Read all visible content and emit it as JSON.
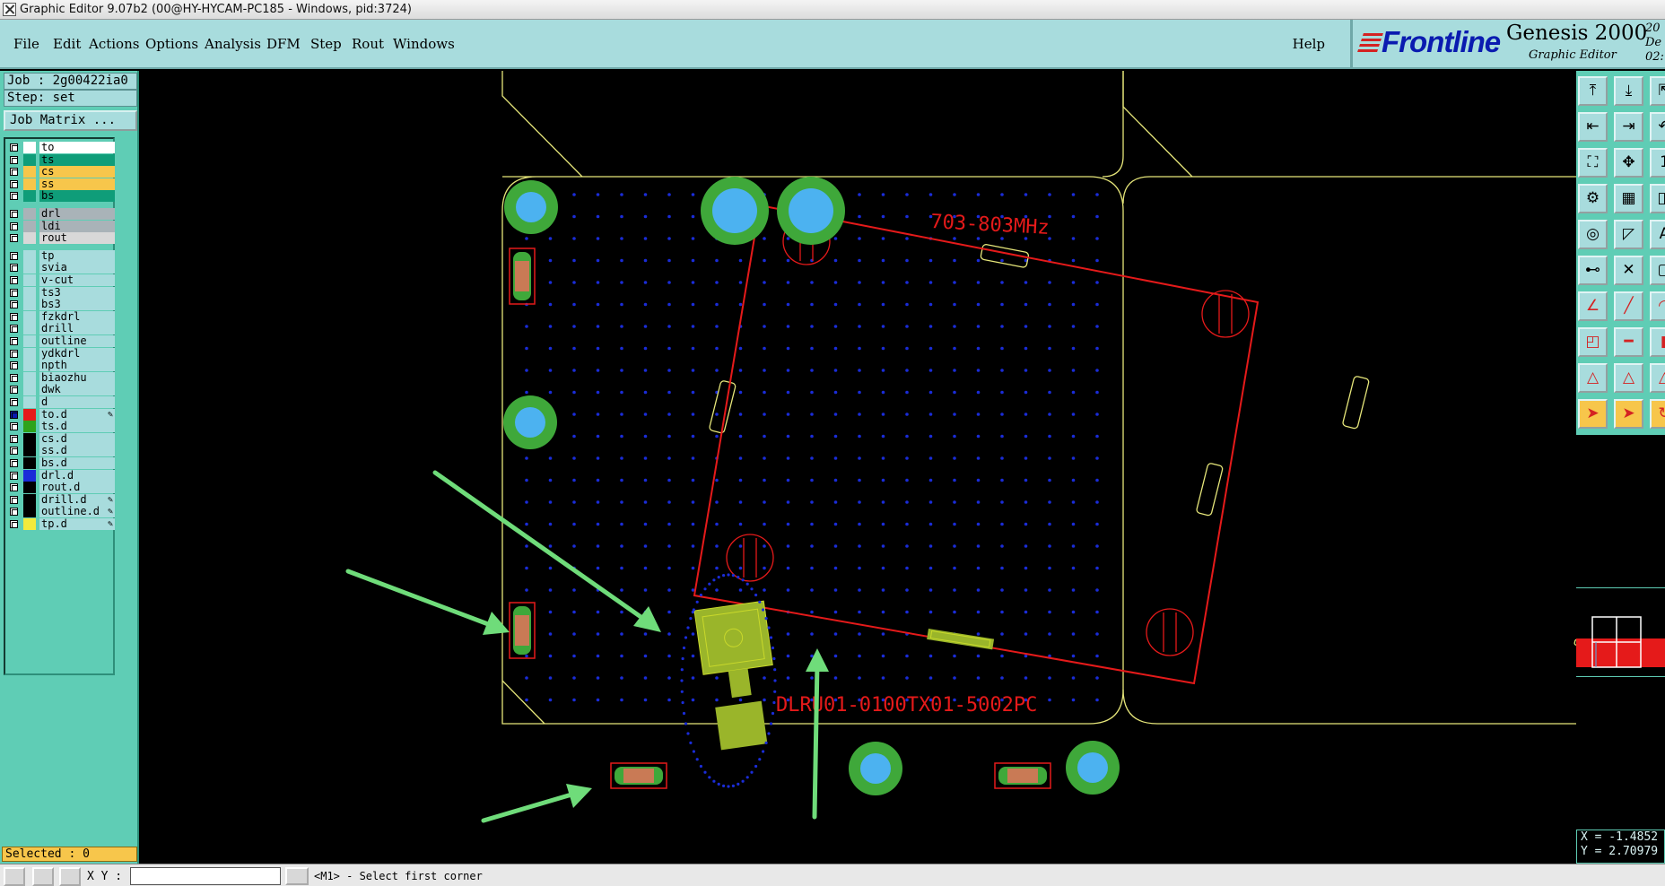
{
  "window": {
    "title": "Graphic Editor 9.07b2 (00@HY-HYCAM-PC185 - Windows, pid:3724)"
  },
  "menu": {
    "items": [
      "File",
      "Edit",
      "Actions",
      "Options",
      "Analysis",
      "DFM",
      "Step",
      "Rout",
      "Windows"
    ],
    "help": "Help"
  },
  "logo": {
    "brand": "Frontline",
    "product": "Genesis 2000",
    "subtitle": "Graphic Editor",
    "date_line1": "20 De",
    "date_line2": "02:"
  },
  "job": {
    "job_label": "Job : 2g00422ia0",
    "step_label": "Step: set",
    "matrix_button": "Job Matrix ..."
  },
  "layers": [
    {
      "name": "to",
      "color": "#ffffff",
      "active": false,
      "brush": false
    },
    {
      "name": "ts",
      "color": "#0f9d79",
      "active": false,
      "brush": false
    },
    {
      "name": "cs",
      "color": "#f7c64b",
      "active": false,
      "brush": false
    },
    {
      "name": "ss",
      "color": "#f7c64b",
      "active": false,
      "brush": false
    },
    {
      "name": "bs",
      "color": "#0f9d79",
      "active": false,
      "brush": false
    },
    {
      "name": "drl",
      "color": "#a9b3b8",
      "active": false,
      "brush": false
    },
    {
      "name": "ldi",
      "color": "#a9b3b8",
      "active": false,
      "brush": false
    },
    {
      "name": "rout",
      "color": "#d8d8d8",
      "active": false,
      "brush": false
    },
    {
      "name": "tp",
      "color": "#a8dcdd",
      "active": false,
      "brush": false
    },
    {
      "name": "svia",
      "color": "#a8dcdd",
      "active": false,
      "brush": false
    },
    {
      "name": "v-cut",
      "color": "#a8dcdd",
      "active": false,
      "brush": false
    },
    {
      "name": "ts3",
      "color": "#a8dcdd",
      "active": false,
      "brush": false
    },
    {
      "name": "bs3",
      "color": "#a8dcdd",
      "active": false,
      "brush": false
    },
    {
      "name": "fzkdrl",
      "color": "#a8dcdd",
      "active": false,
      "brush": false
    },
    {
      "name": "drill",
      "color": "#a8dcdd",
      "active": false,
      "brush": false
    },
    {
      "name": "outline",
      "color": "#a8dcdd",
      "active": false,
      "brush": false
    },
    {
      "name": "ydkdrl",
      "color": "#a8dcdd",
      "active": false,
      "brush": false
    },
    {
      "name": "npth",
      "color": "#a8dcdd",
      "active": false,
      "brush": false
    },
    {
      "name": "biaozhu",
      "color": "#a8dcdd",
      "active": false,
      "brush": false
    },
    {
      "name": "dwk",
      "color": "#a8dcdd",
      "active": false,
      "brush": false
    },
    {
      "name": "d",
      "color": "#a8dcdd",
      "active": false,
      "brush": false
    },
    {
      "name": "to.d",
      "color": "#e51a1a",
      "active": true,
      "brush": true
    },
    {
      "name": "ts.d",
      "color": "#2ea31c",
      "active": false,
      "brush": false
    },
    {
      "name": "cs.d",
      "color": "#000000",
      "active": false,
      "brush": false
    },
    {
      "name": "ss.d",
      "color": "#000000",
      "active": false,
      "brush": false
    },
    {
      "name": "bs.d",
      "color": "#000000",
      "active": false,
      "brush": false
    },
    {
      "name": "drl.d",
      "color": "#1a2cd8",
      "active": false,
      "brush": false
    },
    {
      "name": "rout.d",
      "color": "#000000",
      "active": false,
      "brush": false
    },
    {
      "name": "drill.d",
      "color": "#000000",
      "active": false,
      "brush": true
    },
    {
      "name": "outline.d",
      "color": "#000000",
      "active": false,
      "brush": true
    },
    {
      "name": "tp.d",
      "color": "#f2ea3c",
      "active": false,
      "brush": true
    }
  ],
  "selected": "Selected : 0",
  "canvas": {
    "label_freq": "703-803MHz",
    "label_part": "DLRU01-0100TX01-5002PC",
    "colors": {
      "outline": "#e6e67a",
      "annotation": "#e51a1a",
      "pad_green": "#3fa83a",
      "hole_blue": "#4cb2f0",
      "dot_blue": "#1a2cd8",
      "component": "#9ab52a",
      "arrow": "#6fdc7a"
    }
  },
  "toolbar_icons": [
    "zoom-home-icon",
    "zoom-out-icon",
    "zoom-in-icon",
    "pan-left-icon",
    "pan-right-icon",
    "undo-icon",
    "fit-icon",
    "center-icon",
    "one-to-one-icon",
    "snap-icon",
    "grid-icon",
    "highlight-icon",
    "measure-icon",
    "line-icon",
    "text-icon",
    "connect-icon",
    "cross-icon",
    "unknown-icon",
    "angle-icon",
    "slash-icon",
    "arc-icon",
    "pad-icon",
    "dash-icon",
    "bar-icon",
    "triangle-icon",
    "delta-icon",
    "delta-alt-icon",
    "select-arrow-icon",
    "select-arrow-alt-icon",
    "rotate-icon"
  ],
  "coords": {
    "x": "X = -1.4852",
    "y": "Y = 2.70979"
  },
  "bottom": {
    "xy_label": "X Y :",
    "status": "<M1> - Select first corner"
  }
}
